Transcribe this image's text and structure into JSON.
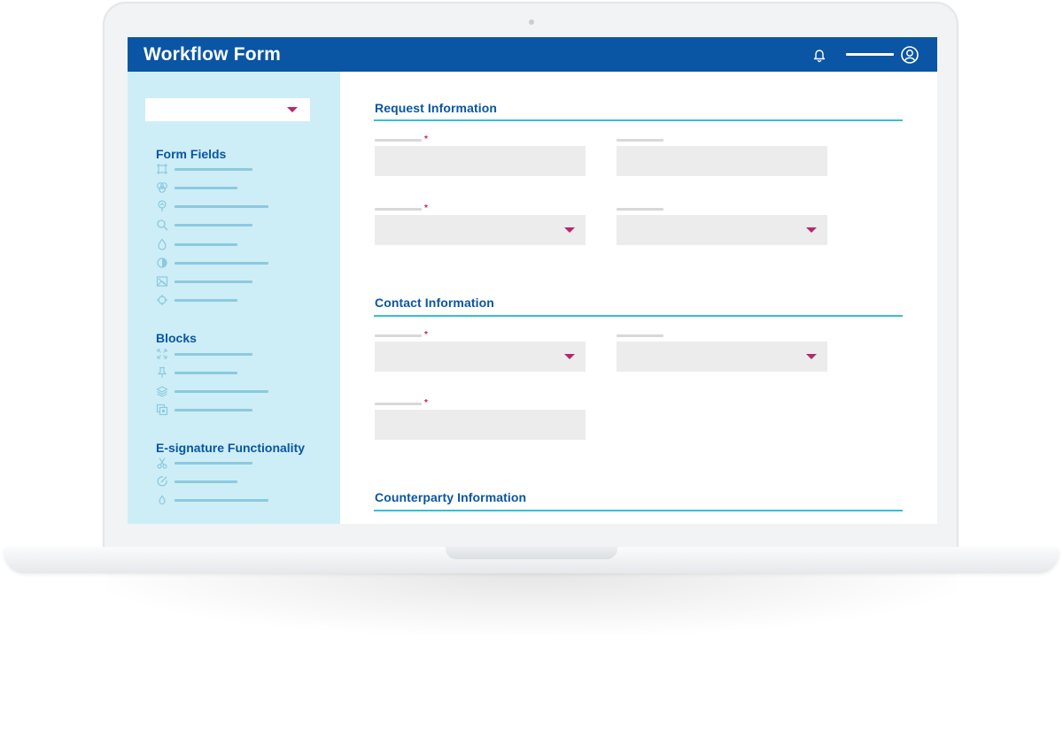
{
  "app": {
    "title": "Workflow Form"
  },
  "colors": {
    "header": "#0a55a4",
    "sidebar": "#cdeef6",
    "accent_rule": "#37bfd3",
    "caret": "#b5286d",
    "required": "#d21f50"
  },
  "header": {
    "notification_icon": "bell-icon",
    "user_icon": "user-circle-icon"
  },
  "sidebar": {
    "selector_value": "",
    "sections": [
      {
        "heading": "Form Fields",
        "items": [
          {
            "icon": "frame-icon"
          },
          {
            "icon": "circles-icon"
          },
          {
            "icon": "pin-icon"
          },
          {
            "icon": "search-icon"
          },
          {
            "icon": "drop-icon"
          },
          {
            "icon": "half-circle-icon"
          },
          {
            "icon": "image-icon"
          },
          {
            "icon": "crosshair-icon"
          }
        ]
      },
      {
        "heading": "Blocks",
        "items": [
          {
            "icon": "expand-icon"
          },
          {
            "icon": "pushpin-icon"
          },
          {
            "icon": "layers-icon"
          },
          {
            "icon": "copy-icon"
          }
        ]
      },
      {
        "heading": "E-signature Functionality",
        "items": [
          {
            "icon": "scissors-icon"
          },
          {
            "icon": "edit-circle-icon"
          },
          {
            "icon": "drop-small-icon"
          }
        ]
      }
    ]
  },
  "form": {
    "sections": [
      {
        "title": "Request Information"
      },
      {
        "title": "Contact Information"
      },
      {
        "title": "Counterparty Information"
      }
    ],
    "required_marker": "*"
  }
}
